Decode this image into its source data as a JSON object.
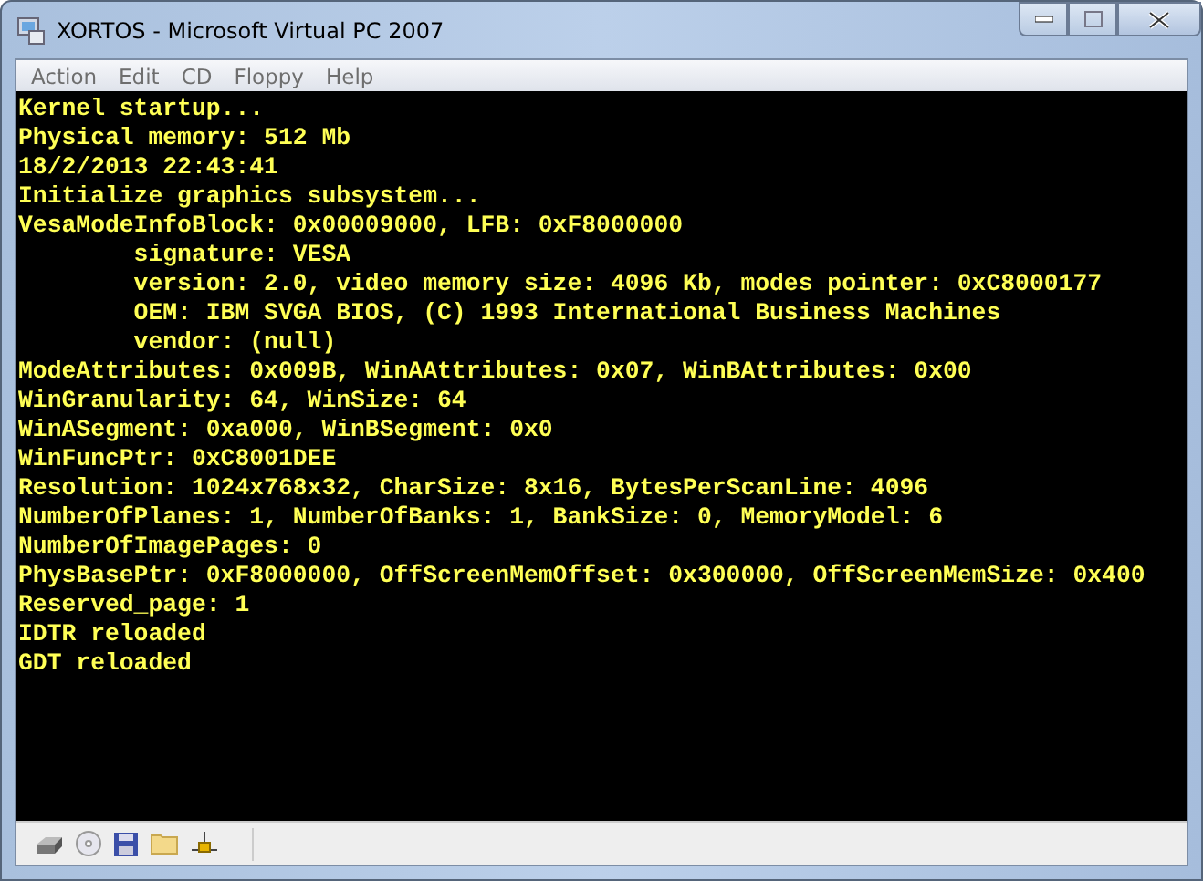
{
  "window": {
    "title": "XORTOS - Microsoft Virtual PC 2007"
  },
  "menu": [
    "Action",
    "Edit",
    "CD",
    "Floppy",
    "Help"
  ],
  "console": {
    "lines": [
      "Kernel startup...",
      "Physical memory: 512 Mb",
      "18/2/2013 22:43:41",
      "Initialize graphics subsystem...",
      "VesaModeInfoBlock: 0x00009000, LFB: 0xF8000000",
      "        signature: VESA",
      "        version: 2.0, video memory size: 4096 Kb, modes pointer: 0xC8000177",
      "        OEM: IBM SVGA BIOS, (C) 1993 International Business Machines",
      "        vendor: (null)",
      "ModeAttributes: 0x009B, WinAAttributes: 0x07, WinBAttributes: 0x00",
      "WinGranularity: 64, WinSize: 64",
      "WinASegment: 0xa000, WinBSegment: 0x0",
      "WinFuncPtr: 0xC8001DEE",
      "Resolution: 1024x768x32, CharSize: 8x16, BytesPerScanLine: 4096",
      "NumberOfPlanes: 1, NumberOfBanks: 1, BankSize: 0, MemoryModel: 6",
      "NumberOfImagePages: 0",
      "PhysBasePtr: 0xF8000000, OffScreenMemOffset: 0x300000, OffScreenMemSize: 0x400",
      "Reserved_page: 1",
      "IDTR reloaded",
      "GDT reloaded"
    ]
  }
}
